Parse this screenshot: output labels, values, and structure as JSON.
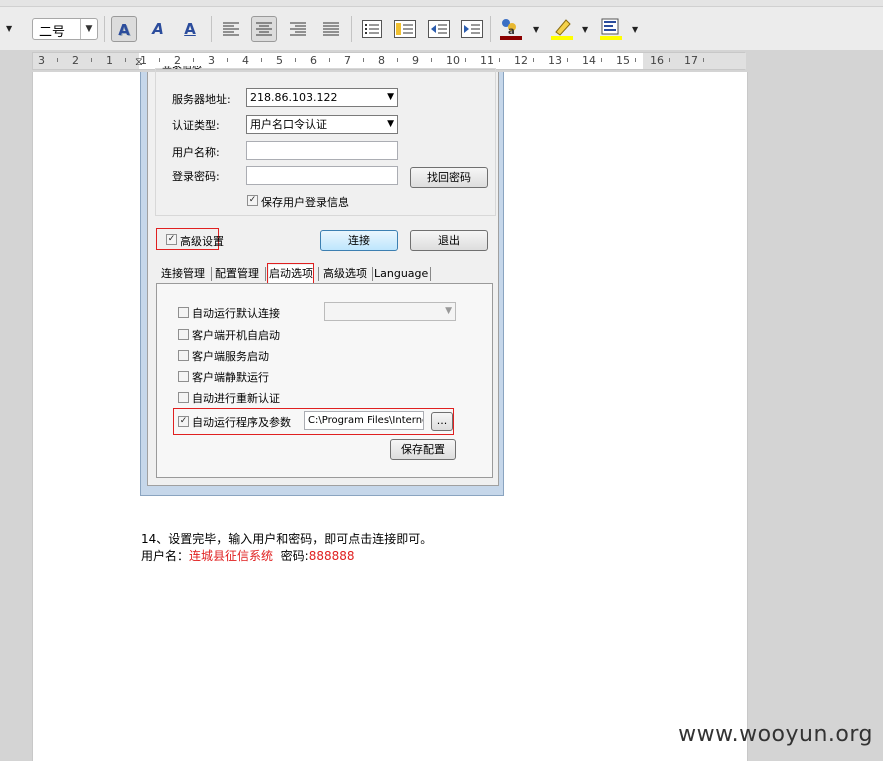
{
  "toolbar": {
    "font_size_value": "二号",
    "buttons": [
      {
        "name": "text-shadow-icon",
        "glyph": "A"
      },
      {
        "name": "text-outline-icon",
        "glyph": "A"
      },
      {
        "name": "text-underline-style-icon",
        "glyph": "A"
      },
      {
        "name": "align-left-icon",
        "glyph": "≡"
      },
      {
        "name": "align-center-icon",
        "glyph": "≡"
      },
      {
        "name": "align-right-icon",
        "glyph": "≡"
      },
      {
        "name": "align-justify-icon",
        "glyph": "≡"
      },
      {
        "name": "list-icon",
        "glyph": "☰"
      },
      {
        "name": "numbered-list-icon",
        "glyph": "☰"
      },
      {
        "name": "decrease-indent-icon",
        "glyph": "⇤"
      },
      {
        "name": "increase-indent-icon",
        "glyph": "⇥"
      },
      {
        "name": "font-color-icon",
        "glyph": "A"
      },
      {
        "name": "highlight-icon",
        "glyph": "✎"
      },
      {
        "name": "background-color-icon",
        "glyph": "▤"
      }
    ],
    "colors": {
      "font_color": "#8b0000",
      "highlight": "#ffff00",
      "background": "#ffff00"
    }
  },
  "ruler": {
    "labels": [
      "3",
      "2",
      "1",
      "1",
      "2",
      "3",
      "4",
      "5",
      "6",
      "7",
      "8",
      "9",
      "10",
      "11",
      "12",
      "13",
      "14",
      "15",
      "16",
      "17"
    ]
  },
  "dialog": {
    "group_label": "登录信息",
    "server_label": "服务器地址:",
    "server_value": "218.86.103.122",
    "auth_label": "认证类型:",
    "auth_value": "用户名口令认证",
    "username_label": "用户名称:",
    "username_value": "",
    "password_label": "登录密码:",
    "password_value": "",
    "recover_button": "找回密码",
    "save_login_label": "保存用户登录信息",
    "save_login_checked": true,
    "advanced_label": "高级设置",
    "advanced_checked": true,
    "connect_button": "连接",
    "exit_button": "退出",
    "tabs": [
      "连接管理",
      "配置管理",
      "启动选项",
      "高级选项",
      "Language"
    ],
    "active_tab": "启动选项",
    "options": [
      {
        "label": "自动运行默认连接",
        "checked": false
      },
      {
        "label": "客户端开机自启动",
        "checked": false
      },
      {
        "label": "客户端服务启动",
        "checked": false
      },
      {
        "label": "客户端静默运行",
        "checked": false
      },
      {
        "label": "自动进行重新认证",
        "checked": false
      },
      {
        "label": "自动运行程序及参数",
        "checked": true
      }
    ],
    "default_connection_value": "",
    "program_path_value": "C:\\Program Files\\Internet",
    "browse_button": "...",
    "save_config_button": "保存配置"
  },
  "document": {
    "line1": "14、设置完毕，输入用户和密码，即可点击连接即可。",
    "line2_prefix": "用户名：",
    "line2_username": "连城县征信系统",
    "line2_password_label": "密码:",
    "line2_password": "888888"
  },
  "watermark": "www.wooyun.org"
}
